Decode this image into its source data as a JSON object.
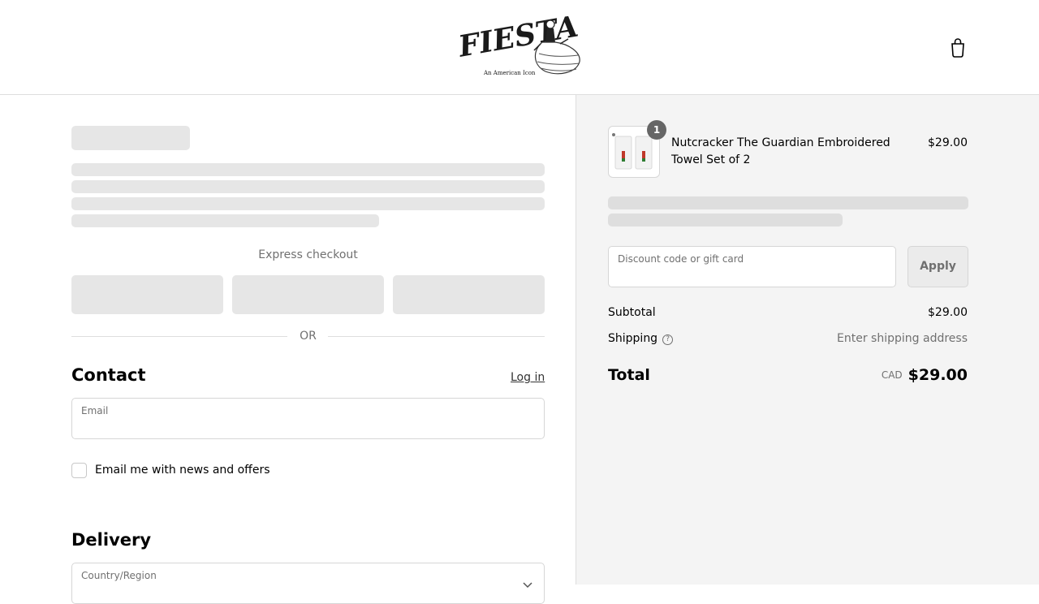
{
  "header": {
    "logo_text": "FIESTA",
    "logo_tagline": "An American Icon",
    "cart_icon": "shopping-bag-icon"
  },
  "checkout": {
    "express_label": "Express checkout",
    "or_label": "OR",
    "contact": {
      "title": "Contact",
      "login_label": "Log in",
      "email_label": "Email",
      "newsletter_label": "Email me with news and offers"
    },
    "delivery": {
      "title": "Delivery",
      "country_label": "Country/Region",
      "chevron_icon": "chevron-down-icon"
    }
  },
  "summary": {
    "item": {
      "name": "Nutcracker The Guardian Embroidered Towel Set of 2",
      "price": "$29.00",
      "quantity": "1"
    },
    "discount_placeholder": "Discount code or gift card",
    "apply_label": "Apply",
    "subtotal_label": "Subtotal",
    "subtotal_value": "$29.00",
    "shipping_label": "Shipping",
    "shipping_value": "Enter shipping address",
    "total_label": "Total",
    "currency": "CAD",
    "total_value": "$29.00"
  }
}
